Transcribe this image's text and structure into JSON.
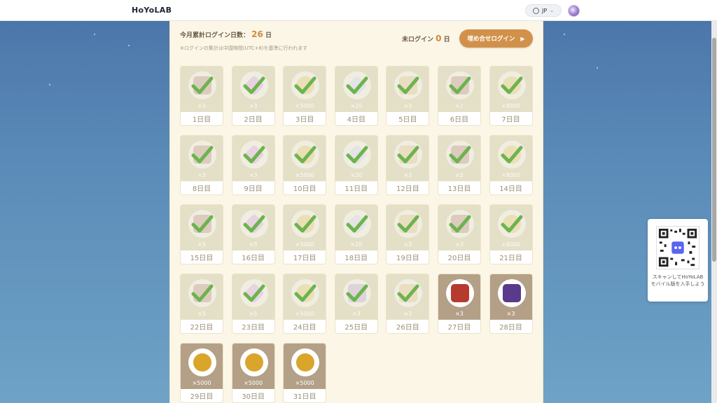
{
  "header": {
    "logo": "HoYoLAB",
    "lang": "JP"
  },
  "summary": {
    "label": "今月累計ログイン日数：",
    "count": "26",
    "unit": "日",
    "note": "※ログインの集計は中国時間(UTC+8)を基準に行われます"
  },
  "missed": {
    "label": "未ログイン",
    "count": "0",
    "unit": "日"
  },
  "makeup_button": {
    "label": "埋め合せログイン",
    "arrow": "▶"
  },
  "qr": {
    "text": "スキャンしてHoYoLABモバイル版を入手しよう"
  },
  "days": [
    {
      "day": "1日目",
      "qty": "×3",
      "item": "tile",
      "color": "#c9a99a",
      "claimed": true
    },
    {
      "day": "2日目",
      "qty": "×3",
      "item": "crystal",
      "color": "#e0b8e6",
      "claimed": true
    },
    {
      "day": "3日目",
      "qty": "×5000",
      "item": "coin",
      "color": "#e8d488",
      "claimed": true
    },
    {
      "day": "4日目",
      "qty": "×20",
      "item": "shard",
      "color": "#d6dceb",
      "claimed": true
    },
    {
      "day": "5日目",
      "qty": "×3",
      "item": "dish",
      "color": "#e6cfa3",
      "claimed": true
    },
    {
      "day": "6日目",
      "qty": "×2",
      "item": "tile",
      "color": "#c9a99a",
      "claimed": true
    },
    {
      "day": "7日目",
      "qty": "×8000",
      "item": "coin",
      "color": "#e8d488",
      "claimed": true
    },
    {
      "day": "8日目",
      "qty": "×3",
      "item": "tile",
      "color": "#c9a99a",
      "claimed": true
    },
    {
      "day": "9日目",
      "qty": "×3",
      "item": "crystal",
      "color": "#e0b8e6",
      "claimed": true
    },
    {
      "day": "10日目",
      "qty": "×5000",
      "item": "coin",
      "color": "#e8d488",
      "claimed": true
    },
    {
      "day": "11日目",
      "qty": "×20",
      "item": "shard",
      "color": "#d6dceb",
      "claimed": true
    },
    {
      "day": "12日目",
      "qty": "×3",
      "item": "skewer",
      "color": "#e1cfa0",
      "claimed": true
    },
    {
      "day": "13日目",
      "qty": "×2",
      "item": "tile",
      "color": "#c9a99a",
      "claimed": true
    },
    {
      "day": "14日目",
      "qty": "×8000",
      "item": "coin",
      "color": "#e8d488",
      "claimed": true
    },
    {
      "day": "15日目",
      "qty": "×5",
      "item": "tile",
      "color": "#c9a99a",
      "claimed": true
    },
    {
      "day": "16日目",
      "qty": "×5",
      "item": "crystal",
      "color": "#e0b8e6",
      "claimed": true
    },
    {
      "day": "17日目",
      "qty": "×5000",
      "item": "coin",
      "color": "#e8d488",
      "claimed": true
    },
    {
      "day": "18日目",
      "qty": "×20",
      "item": "shard",
      "color": "#d6dceb",
      "claimed": true
    },
    {
      "day": "19日目",
      "qty": "×3",
      "item": "dish",
      "color": "#e6cfa3",
      "claimed": true
    },
    {
      "day": "20日目",
      "qty": "×3",
      "item": "tile",
      "color": "#c9a99a",
      "claimed": true
    },
    {
      "day": "21日目",
      "qty": "×8000",
      "item": "coin",
      "color": "#e8d488",
      "claimed": true
    },
    {
      "day": "22日目",
      "qty": "×5",
      "item": "tile",
      "color": "#c9a99a",
      "claimed": true
    },
    {
      "day": "23日目",
      "qty": "×5",
      "item": "crystal",
      "color": "#e0b8e6",
      "claimed": true
    },
    {
      "day": "24日目",
      "qty": "×5000",
      "item": "coin",
      "color": "#e8d488",
      "claimed": true
    },
    {
      "day": "25日目",
      "qty": "×3",
      "item": "paper",
      "color": "#c8bcd6",
      "claimed": true
    },
    {
      "day": "26日目",
      "qty": "×3",
      "item": "dish",
      "color": "#e6cfa3",
      "claimed": true
    },
    {
      "day": "27日目",
      "qty": "×3",
      "item": "book-red",
      "color": "#b63b2e",
      "claimed": false
    },
    {
      "day": "28日目",
      "qty": "×3",
      "item": "book-purple",
      "color": "#5a3a8a",
      "claimed": false
    },
    {
      "day": "29日目",
      "qty": "×5000",
      "item": "gold-coin",
      "color": "#d9a52a",
      "claimed": false
    },
    {
      "day": "30日目",
      "qty": "×5000",
      "item": "gold-coin",
      "color": "#d9a52a",
      "claimed": false
    },
    {
      "day": "31日目",
      "qty": "×5000",
      "item": "gold-coin",
      "color": "#d9a52a",
      "claimed": false
    }
  ]
}
